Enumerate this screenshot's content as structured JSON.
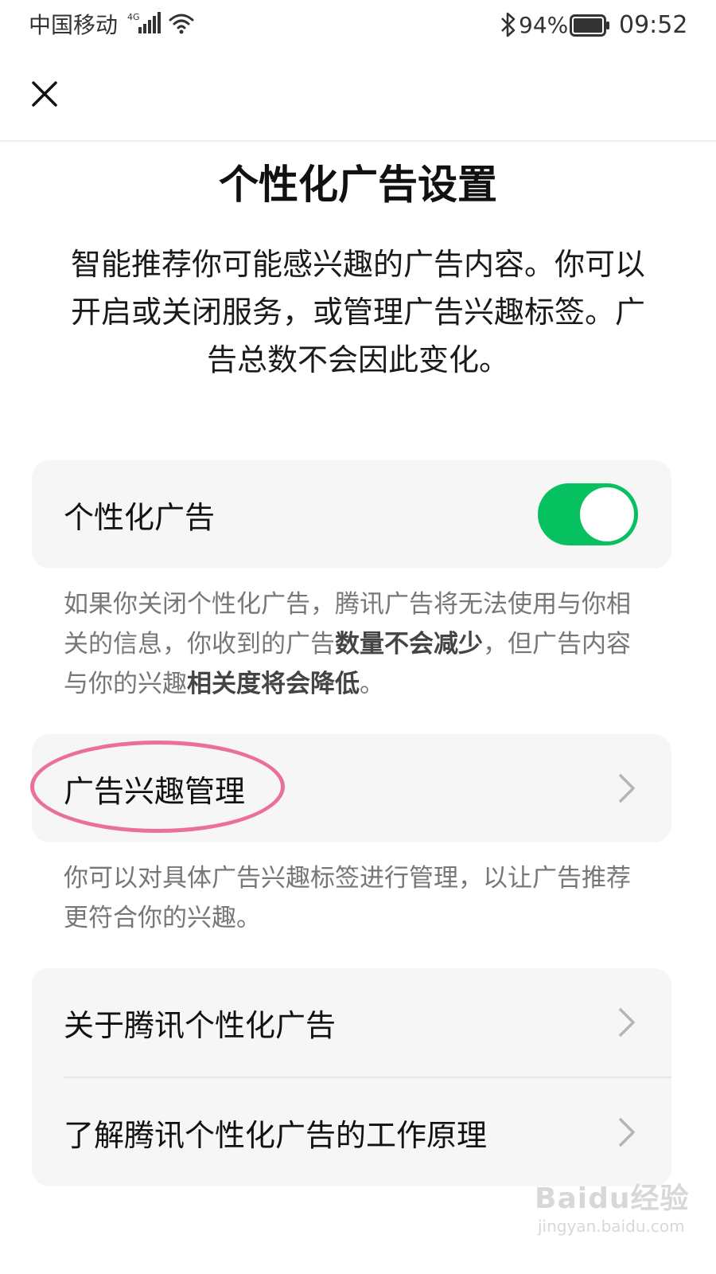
{
  "status_bar": {
    "carrier": "中国移动",
    "network": "4G",
    "battery": "94%",
    "time": "09:52"
  },
  "title": "个性化广告设置",
  "intro": "智能推荐你可能感兴趣的广告内容。你可以开启或关闭服务，或管理广告兴趣标签。广告总数不会因此变化。",
  "personalized": {
    "label": "个性化广告",
    "enabled": true,
    "toggle_color": "#07c160",
    "desc_1": "如果你关闭个性化广告，腾讯广告将无法使用与你相关的信息，你收到的广告",
    "desc_bold_1": "数量不会减少",
    "desc_2": "，但广告内容与你的兴趣",
    "desc_bold_2": "相关度将会降低",
    "desc_3": "。"
  },
  "interest": {
    "label": "广告兴趣管理",
    "desc": "你可以对具体广告兴趣标签进行管理，以让广告推荐更符合你的兴趣。",
    "highlight_color": "#ea6f99"
  },
  "links": [
    {
      "label": "关于腾讯个性化广告"
    },
    {
      "label": "了解腾讯个性化广告的工作原理"
    }
  ],
  "watermark": {
    "brand": "Baidu经验",
    "url": "jingyan.baidu.com"
  }
}
